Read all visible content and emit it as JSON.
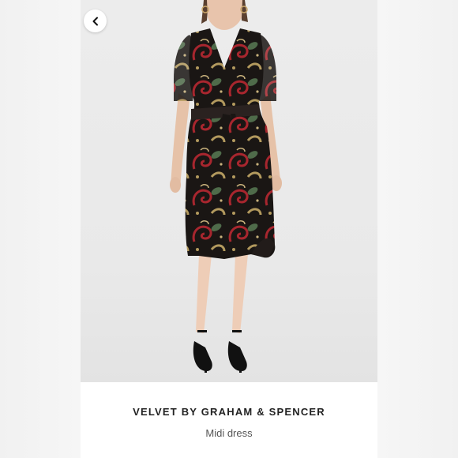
{
  "product": {
    "brand": "VELVET BY GRAHAM & SPENCER",
    "subtitle": "Midi dress"
  },
  "navigation": {
    "back_icon": "chevron-left-icon"
  },
  "colors": {
    "background": "#f4f4f4",
    "card": "#ffffff",
    "brand_text": "#222222",
    "subtitle_text": "#555555",
    "dress_base": "#1a1614",
    "paisley_red": "#a8262e",
    "paisley_gold": "#b39a5e",
    "paisley_green": "#4f6b4a"
  }
}
